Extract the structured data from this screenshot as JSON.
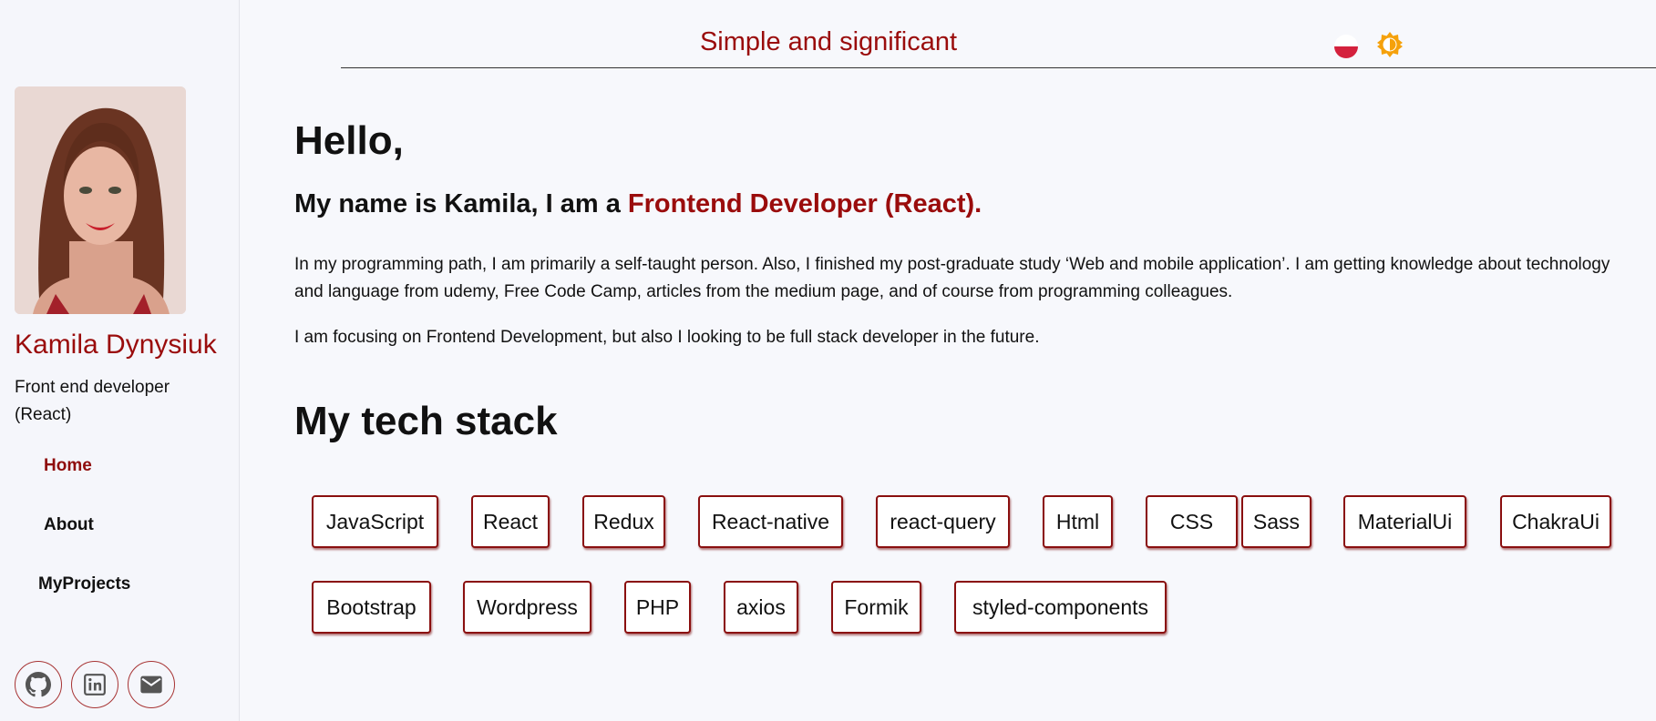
{
  "sidebar": {
    "name": "Kamila Dynysiuk",
    "role": "Front end developer (React)",
    "nav": [
      {
        "label": "Home",
        "active": true
      },
      {
        "label": "About",
        "active": false
      },
      {
        "label": "MyProjects",
        "active": false
      }
    ],
    "social": [
      {
        "icon": "github-icon"
      },
      {
        "icon": "linkedin-icon"
      },
      {
        "icon": "mail-icon"
      }
    ]
  },
  "header": {
    "title": "Simple and significant",
    "language_flag": "polish-flag-icon",
    "theme_icon": "sun-icon"
  },
  "main": {
    "greeting": "Hello,",
    "intro_prefix": "My name is Kamila, I am a ",
    "intro_highlight": "Frontend Developer (React).",
    "paragraph1": "In my programming path, I am primarily a self-taught person. Also, I finished my post-graduate study ‘Web and mobile application’. I am getting knowledge about technology and language from udemy, Free Code Camp, articles from the medium page, and of course from programming colleagues.",
    "paragraph2": "I am focusing on Frontend Development, but also I looking to be full stack developer in the future.",
    "stack_title": "My tech stack",
    "tech_stack": [
      "JavaScript",
      "React",
      "Redux",
      "React-native",
      "react-query",
      "Html",
      "CSS",
      "Sass",
      "MaterialUi",
      "ChakraUi",
      "Bootstrap",
      "Wordpress",
      "PHP",
      "axios",
      "Formik",
      "styled-components"
    ]
  },
  "colors": {
    "accent": "#9a0c0c",
    "chip_border": "#8a0f0f",
    "background": "#f7f8fc",
    "theme_icon": "#f5a10b"
  }
}
